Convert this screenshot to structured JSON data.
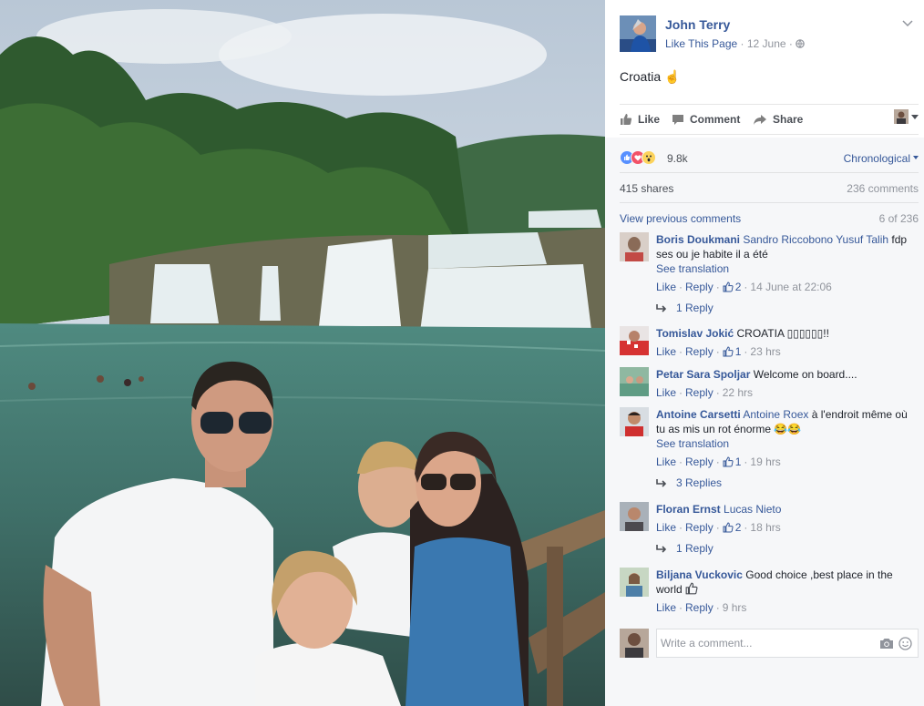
{
  "post": {
    "author": "John Terry",
    "like_page": "Like This Page",
    "date": "12 June",
    "privacy_icon": "globe-icon",
    "caption": "Croatia",
    "caption_emoji": "☝"
  },
  "actions": {
    "like": "Like",
    "comment": "Comment",
    "share": "Share"
  },
  "reactions": {
    "icons": [
      "like-reaction-icon",
      "love-reaction-icon",
      "wow-reaction-icon"
    ],
    "count": "9.8k",
    "sort": "Chronological"
  },
  "stats": {
    "shares": "415 shares",
    "comments": "236 comments"
  },
  "previous": {
    "label": "View previous comments",
    "position": "6 of 236"
  },
  "comments": [
    {
      "name": "Boris Doukmani",
      "tags": "Sandro Riccobono Yusuf Talih",
      "text": "fdp ses ou je habite il a été",
      "see_translation": "See translation",
      "like": "Like",
      "reply": "Reply",
      "likes": "2",
      "time": "14 June at 22:06",
      "replies": "1 Reply"
    },
    {
      "name": "Tomislav Jokić",
      "tags": "",
      "text": "CROATIA ▯▯▯▯▯▯!!",
      "like": "Like",
      "reply": "Reply",
      "likes": "1",
      "time": "23 hrs"
    },
    {
      "name": "Petar Sara Spoljar",
      "tags": "",
      "text": "Welcome on board....",
      "like": "Like",
      "reply": "Reply",
      "time": "22 hrs"
    },
    {
      "name": "Antoine Carsetti",
      "tags": "Antoine Roex",
      "text": "à l'endroit même où tu as mis un rot énorme 😂😂",
      "see_translation": "See translation",
      "like": "Like",
      "reply": "Reply",
      "likes": "1",
      "time": "19 hrs",
      "replies": "3 Replies"
    },
    {
      "name": "Floran Ernst",
      "tags": "Lucas Nieto",
      "text": "",
      "like": "Like",
      "reply": "Reply",
      "likes": "2",
      "time": "18 hrs",
      "replies": "1 Reply"
    },
    {
      "name": "Biljana Vuckovic",
      "tags": "",
      "text": "Good choice ,best place in the world",
      "like": "Like",
      "reply": "Reply",
      "time": "9 hrs"
    }
  ],
  "composer": {
    "placeholder": "Write a comment..."
  },
  "colors": {
    "link": "#365899",
    "muted": "#90949c",
    "panel_bg": "#f6f7f9"
  }
}
